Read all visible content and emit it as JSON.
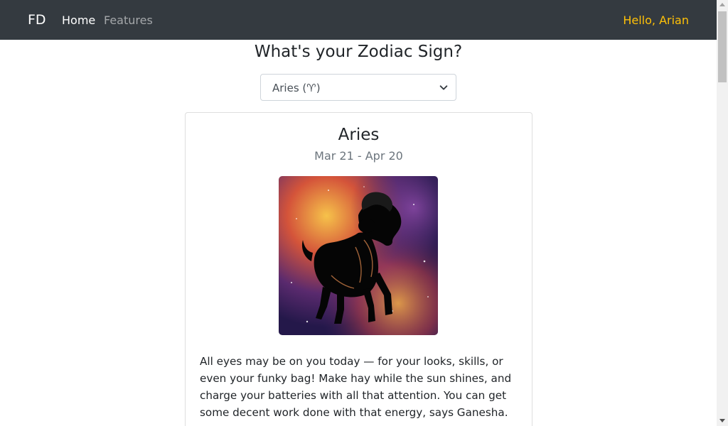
{
  "navbar": {
    "brand": "FD",
    "links": [
      {
        "label": "Home",
        "active": true
      },
      {
        "label": "Features",
        "active": false
      }
    ],
    "greeting": "Hello, Arian"
  },
  "main": {
    "title": "What's your Zodiac Sign?",
    "select": {
      "selected": "Aries (♈︎)"
    },
    "card": {
      "sign": "Aries",
      "dates": "Mar 21 - Apr 20",
      "image_icon": "aries-ram-icon",
      "horoscope": "All eyes may be on you today — for your looks, skills, or even your funky bag! Make hay while the sun shines, and charge your batteries with all that attention. You can get some decent work done with that energy, says Ganesha."
    }
  },
  "colors": {
    "navbar_bg": "#343a40",
    "greeting": "#ffc107",
    "muted": "#6c757d"
  }
}
